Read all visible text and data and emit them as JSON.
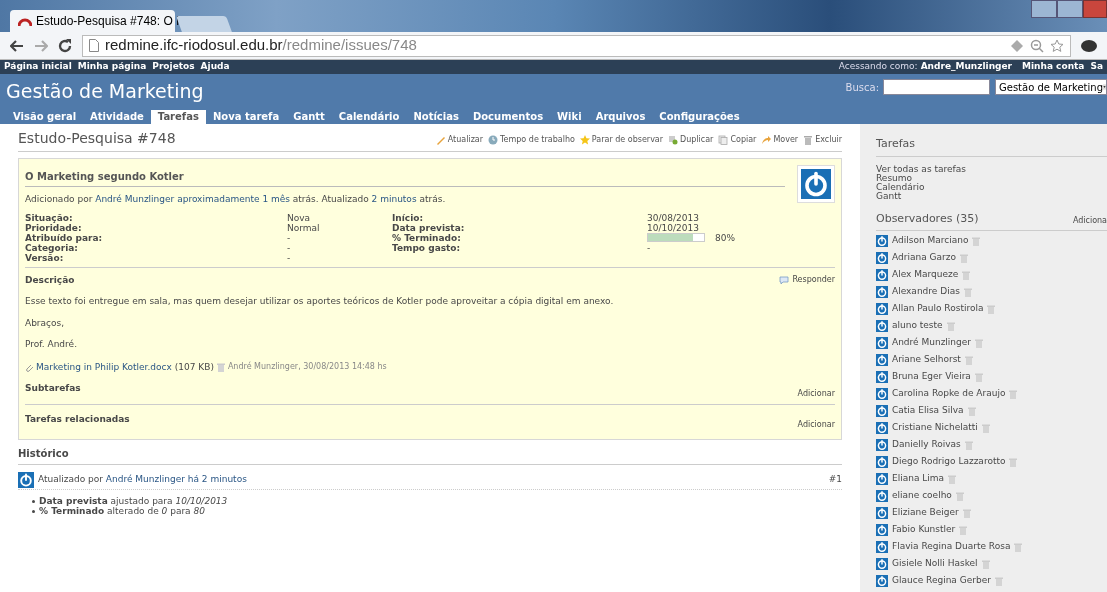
{
  "browser": {
    "tab_title": "Estudo-Pesquisa #748: O I",
    "url_host": "redmine.ifc-riodosul.edu.br",
    "url_path": "/redmine/issues/748"
  },
  "top_menu": {
    "links": [
      "Página inicial",
      "Minha página",
      "Projetos",
      "Ajuda"
    ],
    "logged_label": "Acessando como:",
    "user": "Andre_Munzlinger",
    "account_links": [
      "Minha conta",
      "Sa"
    ]
  },
  "header": {
    "title": "Gestão de Marketing",
    "search_label": "Busca:",
    "project_select": "Gestão de Marketing"
  },
  "tabs": [
    {
      "label": "Visão geral",
      "selected": false
    },
    {
      "label": "Atividade",
      "selected": false
    },
    {
      "label": "Tarefas",
      "selected": true
    },
    {
      "label": "Nova tarefa",
      "selected": false
    },
    {
      "label": "Gantt",
      "selected": false
    },
    {
      "label": "Calendário",
      "selected": false
    },
    {
      "label": "Notícias",
      "selected": false
    },
    {
      "label": "Documentos",
      "selected": false
    },
    {
      "label": "Wiki",
      "selected": false
    },
    {
      "label": "Arquivos",
      "selected": false
    },
    {
      "label": "Configurações",
      "selected": false
    }
  ],
  "issue": {
    "title": "Estudo-Pesquisa #748",
    "actions": [
      {
        "kind": "edit",
        "label": "Atualizar"
      },
      {
        "kind": "time",
        "label": "Tempo de trabalho"
      },
      {
        "kind": "star",
        "label": "Parar de observar"
      },
      {
        "kind": "duplicate",
        "label": "Duplicar"
      },
      {
        "kind": "copy",
        "label": "Copiar"
      },
      {
        "kind": "move",
        "label": "Mover"
      },
      {
        "kind": "delete",
        "label": "Excluir"
      }
    ],
    "subject": "O Marketing segundo Kotler",
    "author_line": [
      {
        "text": "Adicionado por ",
        "link": false
      },
      {
        "text": "André Munzlinger",
        "link": true
      },
      {
        "text": "aproximadamente 1 mês",
        "link": true
      },
      {
        "text": " atrás. Atualizado ",
        "link": false
      },
      {
        "text": "2 minutos",
        "link": true
      },
      {
        "text": " atrás.",
        "link": false
      }
    ],
    "attributes": [
      {
        "label": "Situação:",
        "value": "Nova",
        "label2": "Início:",
        "value2": "30/08/2013"
      },
      {
        "label": "Prioridade:",
        "value": "Normal",
        "label2": "Data prevista:",
        "value2": "10/10/2013"
      },
      {
        "label": "Atribuído para:",
        "value": "-",
        "label2": "% Terminado:",
        "level": 0.8,
        "reading": "80%"
      },
      {
        "label": "Categoria:",
        "value": "-",
        "label2": "Tempo gasto:",
        "value2": "-"
      },
      {
        "label": "Versão:",
        "value": "-"
      }
    ],
    "description_heading": "Descrição",
    "reply": "Responder",
    "description": [
      "Esse texto foi entregue em sala, mas quem desejar utilizar os aportes teóricos de Kotler pode aproveitar a cópia digital em anexo.",
      "Abraços,",
      "Prof. André."
    ],
    "attachment": {
      "name": "Marketing in Philip Kotler.docx",
      "size": "(107 KB)",
      "meta": "André Munzlinger, 30/08/2013 14:48 hs"
    },
    "subtasks": {
      "heading": "Subtarefas",
      "add": "Adicionar"
    },
    "relations": {
      "heading": "Tarefas relacionadas",
      "add": "Adicionar"
    }
  },
  "history": {
    "heading": "Histórico",
    "entries": [
      {
        "prefix": "Atualizado por ",
        "user": "André Munzlinger",
        "ago": "há 2 minutos",
        "number": "#1",
        "details": [
          "**Data prevista** ajustado para *10/10/2013*",
          "**% Terminado** alterado de *0* para *80*"
        ]
      }
    ]
  },
  "sidebar": {
    "heading": "Tarefas",
    "links": [
      "Ver todas as tarefas",
      "Resumo",
      "Calendário",
      "Gantt"
    ],
    "watchers_heading": "Observadores (35)",
    "watchers_add": "Adiciona",
    "watchers": [
      "Adilson Marciano",
      "Adriana Garzo",
      "Alex Marqueze",
      "Alexandre Dias",
      "Allan Paulo Rostirola",
      "aluno teste",
      "André Munzlinger",
      "Ariane Selhorst",
      "Bruna Eger Vieira",
      "Carolina Ropke de Araujo",
      "Catia Elisa Silva",
      "Cristiane Nichelatti",
      "Danielly Roivas",
      "Diego Rodrigo Lazzarotto",
      "Eliana Lima",
      "eliane coelho",
      "Eliziane Beiger",
      "Fabio Kunstler",
      "Flavia Regina Duarte Rosa",
      "Gisiele Nolli Haskel",
      "Glauce Regina Gerber"
    ]
  }
}
